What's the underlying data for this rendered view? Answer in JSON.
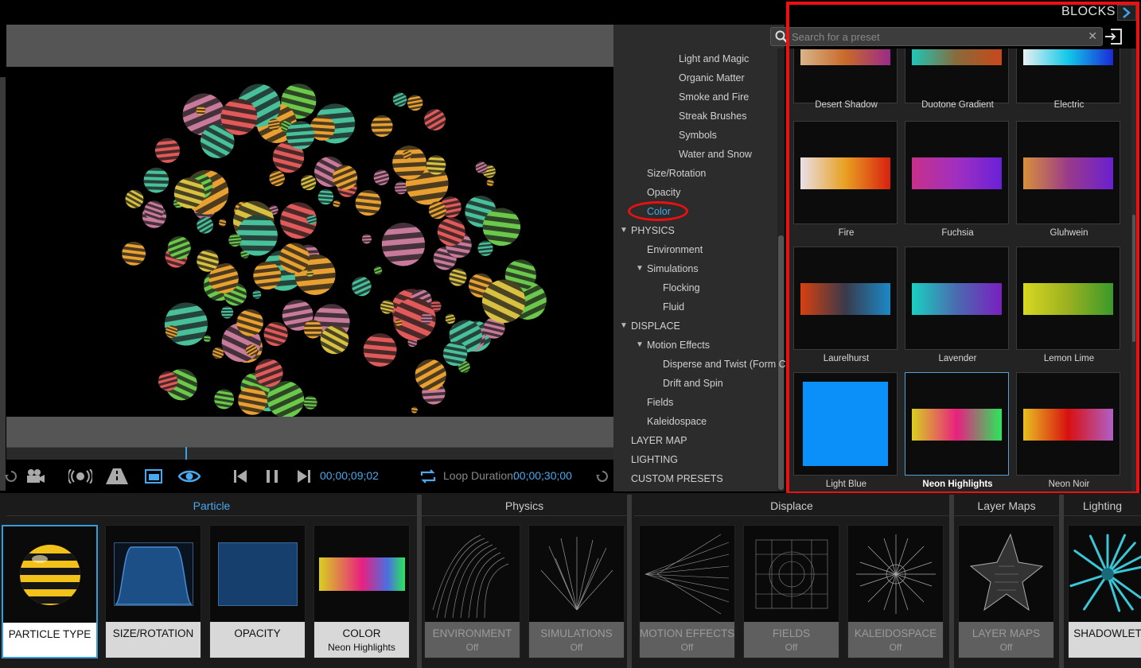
{
  "blocks_panel": {
    "title": "BLOCKS",
    "search_placeholder": "Search for a preset",
    "presets": [
      {
        "label": "Desert Shadow",
        "gradient": [
          "#d9b48a",
          "#c86a2a",
          "#9b2a8a"
        ]
      },
      {
        "label": "Duotone Gradient",
        "gradient": [
          "#1fc6b6",
          "#8a6a3a",
          "#c8481a"
        ]
      },
      {
        "label": "Electric",
        "gradient": [
          "#e8f0f0",
          "#12c8e8",
          "#1a2ad8"
        ]
      },
      {
        "label": "Fire",
        "gradient": [
          "#e8e0e8",
          "#e8a020",
          "#d82010"
        ]
      },
      {
        "label": "Fuchsia",
        "gradient": [
          "#c8308a",
          "#a030c0",
          "#6a20d8"
        ]
      },
      {
        "label": "Gluhwein",
        "gradient": [
          "#d8903a",
          "#9a3a8a",
          "#6a20d0"
        ]
      },
      {
        "label": "Laurelhurst",
        "gradient": [
          "#d84010",
          "#3a3a4a",
          "#1a8ac8"
        ]
      },
      {
        "label": "Lavender",
        "gradient": [
          "#1ad0c0",
          "#4a6ab0",
          "#7a20c0"
        ]
      },
      {
        "label": "Lemon Lime",
        "gradient": [
          "#d8d820",
          "#9ab020",
          "#3a9a2a"
        ]
      },
      {
        "label": "Light Blue",
        "gradient": [
          "#0a90f8",
          "#0a90f8",
          "#0a90f8"
        ]
      },
      {
        "label": "Neon Highlights",
        "gradient": [
          "#d8d020",
          "#e82080",
          "#2ae85a"
        ]
      },
      {
        "label": "Neon Noir",
        "gradient": [
          "#e8c020",
          "#d81010",
          "#b060c8"
        ]
      }
    ],
    "selected_preset": "Neon Highlights"
  },
  "tree": {
    "items": [
      {
        "label": "Light and Magic",
        "level": 3
      },
      {
        "label": "Organic Matter",
        "level": 3
      },
      {
        "label": "Smoke and Fire",
        "level": 3
      },
      {
        "label": "Streak Brushes",
        "level": 3
      },
      {
        "label": "Symbols",
        "level": 3
      },
      {
        "label": "Water and Snow",
        "level": 3
      },
      {
        "label": "Size/Rotation",
        "level": 2
      },
      {
        "label": "Opacity",
        "level": 2
      },
      {
        "label": "Color",
        "level": 2,
        "selected": true
      },
      {
        "label": "PHYSICS",
        "level": 1,
        "expanded": true
      },
      {
        "label": "Environment",
        "level": 2
      },
      {
        "label": "Simulations",
        "level": 2,
        "expanded": true
      },
      {
        "label": "Flocking",
        "level": 3
      },
      {
        "label": "Fluid",
        "level": 3
      },
      {
        "label": "DISPLACE",
        "level": 1,
        "expanded": true
      },
      {
        "label": "Motion Effects",
        "level": 2,
        "expanded": true
      },
      {
        "label": "Disperse and Twist (Form C",
        "level": 3
      },
      {
        "label": "Drift and Spin",
        "level": 3
      },
      {
        "label": "Fields",
        "level": 2
      },
      {
        "label": "Kaleidospace",
        "level": 2
      },
      {
        "label": "LAYER MAP",
        "level": 1
      },
      {
        "label": "LIGHTING",
        "level": 1
      },
      {
        "label": "CUSTOM PRESETS",
        "level": 1
      }
    ]
  },
  "transport": {
    "current_time": "00;00;09;02",
    "loop_label": "Loop Duration:",
    "loop_duration": "00;00;30;00"
  },
  "bottom": {
    "groups": [
      {
        "label": "Particle",
        "active": true
      },
      {
        "label": "Physics"
      },
      {
        "label": "Displace"
      },
      {
        "label": "Layer Maps"
      },
      {
        "label": "Lighting"
      }
    ],
    "cards": [
      {
        "title": "PARTICLE TYPE",
        "sub": "",
        "state": "selected"
      },
      {
        "title": "SIZE/ROTATION",
        "sub": "",
        "state": "on"
      },
      {
        "title": "OPACITY",
        "sub": "",
        "state": "on"
      },
      {
        "title": "COLOR",
        "sub": "Neon Highlights",
        "state": "on"
      },
      {
        "title": "ENVIRONMENT",
        "sub": "Off",
        "state": "off"
      },
      {
        "title": "SIMULATIONS",
        "sub": "Off",
        "state": "off"
      },
      {
        "title": "MOTION EFFECTS",
        "sub": "Off",
        "state": "off"
      },
      {
        "title": "FIELDS",
        "sub": "Off",
        "state": "off"
      },
      {
        "title": "KALEIDOSPACE",
        "sub": "Off",
        "state": "off"
      },
      {
        "title": "LAYER MAPS",
        "sub": "Off",
        "state": "off"
      },
      {
        "title": "SHADOWLET",
        "sub": "",
        "state": "on"
      }
    ]
  },
  "colors": {
    "accent": "#4aa8ec",
    "highlight_frame": "#ee1010"
  }
}
